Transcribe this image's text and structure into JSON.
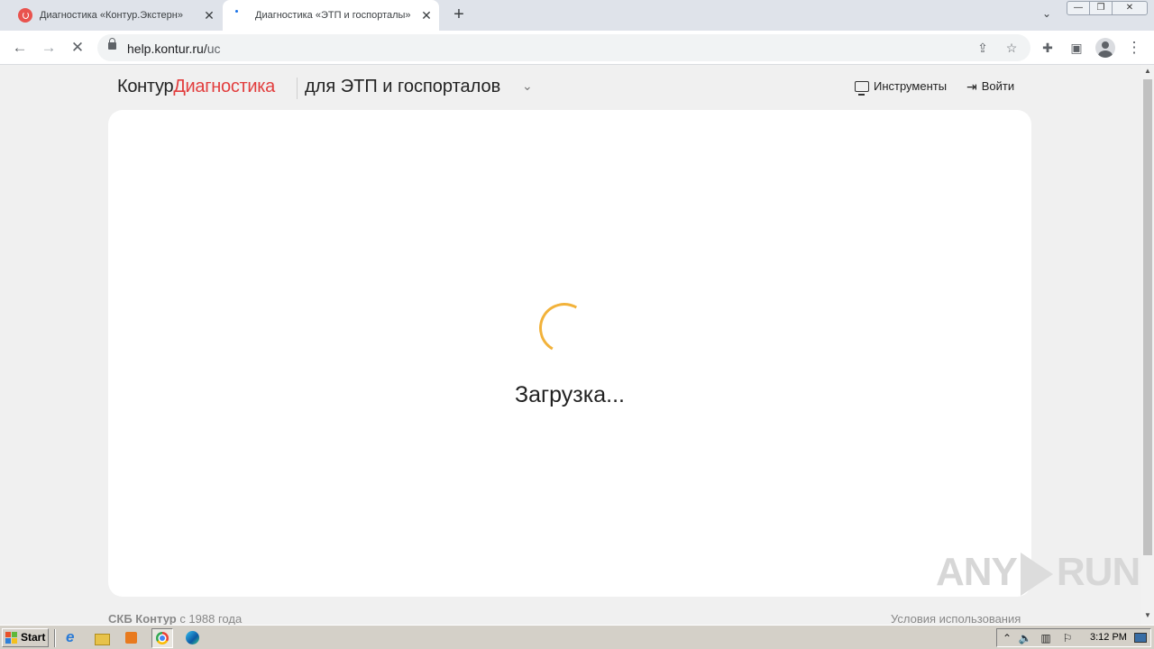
{
  "browser": {
    "tabs": [
      {
        "title": "Диагностика «Контур.Экстерн»",
        "close": "✕"
      },
      {
        "title": "Диагностика «ЭТП и госпорталы»",
        "close": "✕"
      }
    ],
    "new_tab": "+",
    "tab_search": "⌄",
    "window_controls": {
      "minimize": "—",
      "maximize": "❐",
      "close": "✕"
    },
    "url_host": "help.kontur.ru/",
    "url_path": "uc",
    "nav_icons": {
      "back": "←",
      "forward": "→",
      "stop": "✕"
    },
    "omnibox_icons": {
      "share": "⇪",
      "bookmark": "☆"
    },
    "toolbar_icons": {
      "extensions": "✚",
      "side_panel": "▣",
      "menu": "⋮"
    }
  },
  "site": {
    "logo_brand": "Контур",
    "logo_product": "Диагностика",
    "product_name": "для ЭТП и госпорталов",
    "product_chevron": "⌄",
    "tools_label": "Инструменты",
    "login_label": "Войти",
    "login_icon": "⇥",
    "loading_text": "Загрузка...",
    "spinner_color": "#f2b23a",
    "brand_red": "#e23e3e",
    "footer_company": "СКБ Контур",
    "footer_since": " с 1988 года",
    "footer_terms": "Условия использования"
  },
  "watermark": {
    "left": "ANY",
    "right": "RUN"
  },
  "scrollbar": {
    "up": "▲",
    "down": "▼"
  },
  "taskbar": {
    "start_label": "Start",
    "tray": {
      "arrow": "⌃",
      "volume": "🔈",
      "network": "▥",
      "flag": "⚐"
    },
    "clock": "3:12 PM"
  }
}
